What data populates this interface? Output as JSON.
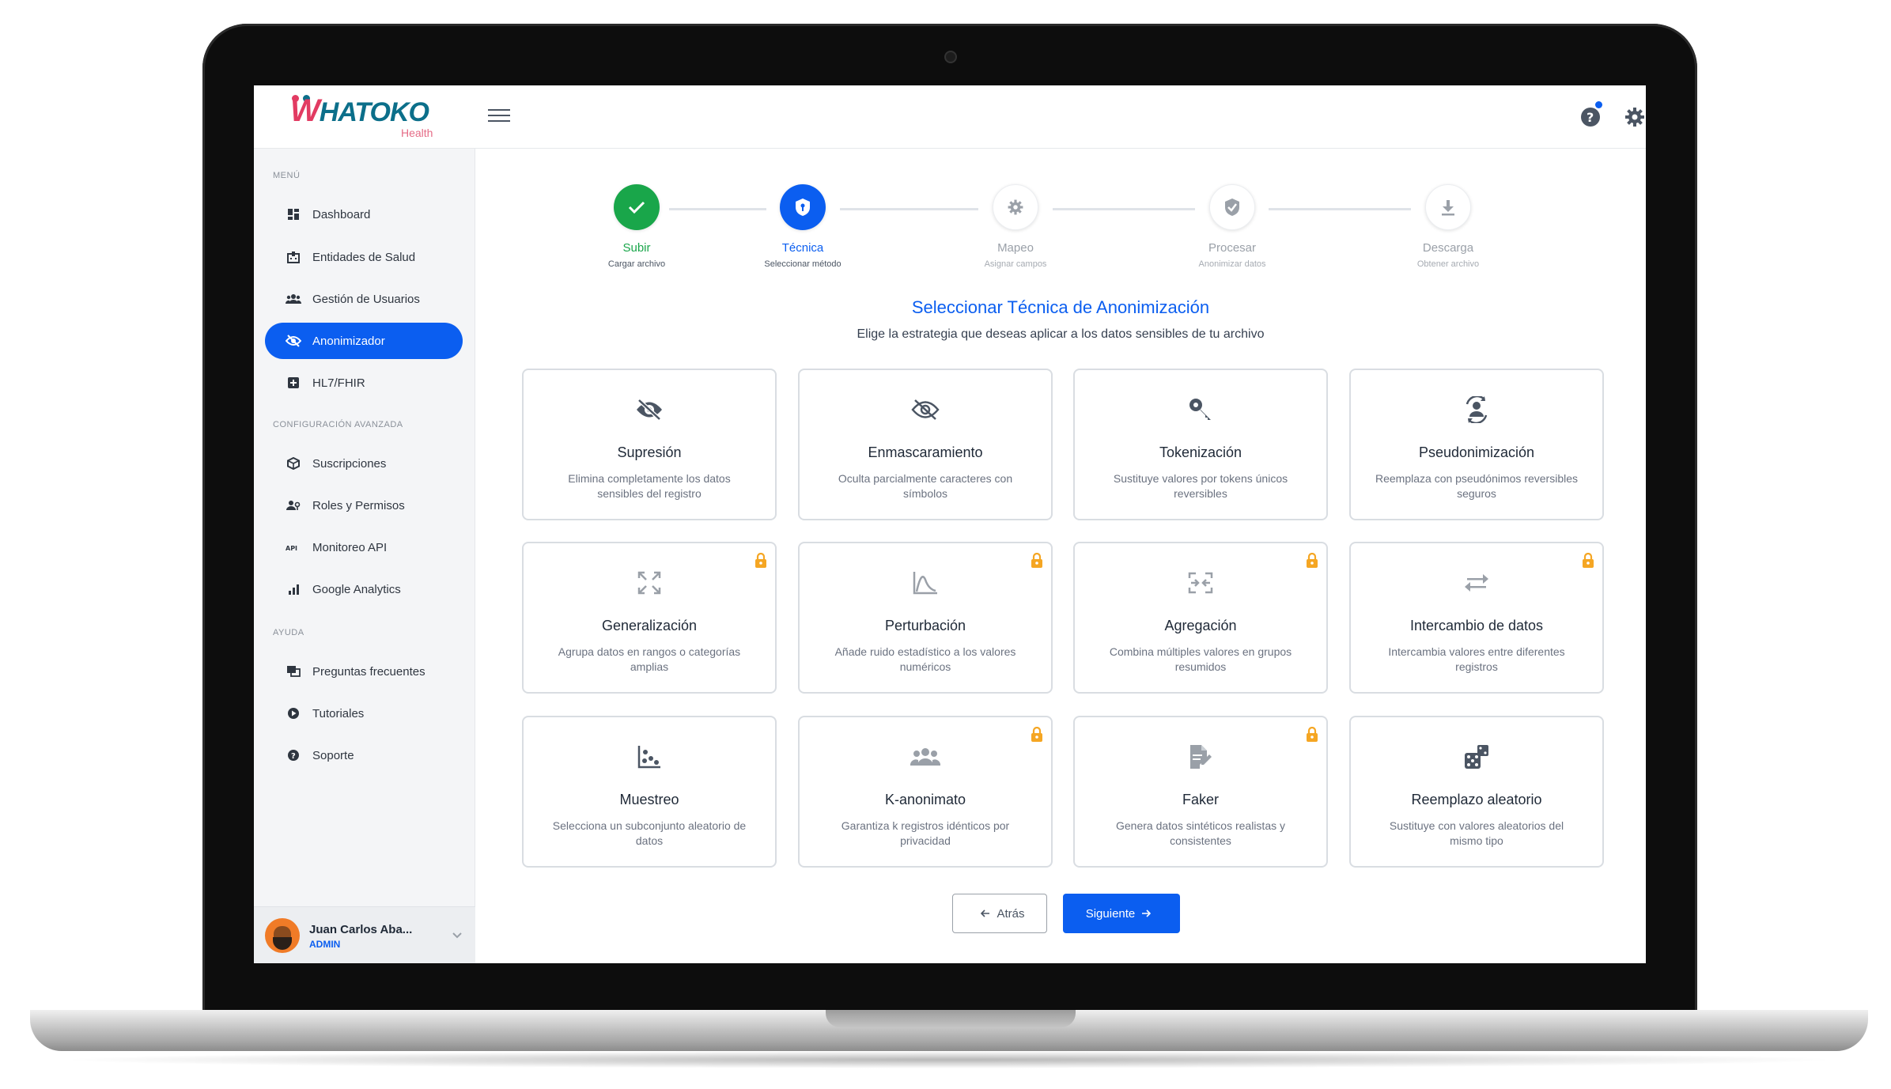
{
  "app": {
    "logo_text": "HATOKO",
    "logo_w": "W",
    "logo_sub": "Health"
  },
  "sidebar": {
    "sections": [
      "MENÚ",
      "CONFIGURACIÓN AVANZADA",
      "AYUDA"
    ],
    "items": [
      {
        "label": "Dashboard",
        "icon": "dashboard-icon"
      },
      {
        "label": "Entidades de Salud",
        "icon": "hospital-icon"
      },
      {
        "label": "Gestión de Usuarios",
        "icon": "users-icon"
      },
      {
        "label": "Anonimizador",
        "icon": "eye-off-icon",
        "active": true
      },
      {
        "label": "HL7/FHIR",
        "icon": "medical-plus-icon"
      },
      {
        "label": "Suscripciones",
        "icon": "cube-icon"
      },
      {
        "label": "Roles y Permisos",
        "icon": "user-key-icon"
      },
      {
        "label": "Monitoreo API",
        "icon": "api-icon"
      },
      {
        "label": "Google Analytics",
        "icon": "bar-chart-icon"
      },
      {
        "label": "Preguntas frecuentes",
        "icon": "faq-icon"
      },
      {
        "label": "Tutoriales",
        "icon": "play-circle-icon"
      },
      {
        "label": "Soporte",
        "icon": "help-circle-icon"
      }
    ],
    "user": {
      "name": "Juan Carlos Aba...",
      "role": "ADMIN"
    }
  },
  "stepper": [
    {
      "title": "Subir",
      "sub": "Cargar archivo",
      "state": "done",
      "icon": "check-icon"
    },
    {
      "title": "Técnica",
      "sub": "Seleccionar método",
      "state": "current",
      "icon": "shield-icon"
    },
    {
      "title": "Mapeo",
      "sub": "Asignar campos",
      "state": "pending",
      "icon": "gear-icon"
    },
    {
      "title": "Procesar",
      "sub": "Anonimizar datos",
      "state": "pending",
      "icon": "shield-check-icon"
    },
    {
      "title": "Descarga",
      "sub": "Obtener archivo",
      "state": "pending",
      "icon": "download-icon"
    }
  ],
  "main": {
    "title": "Seleccionar Técnica de Anonimización",
    "subtitle": "Elige la estrategia que deseas aplicar a los datos sensibles de tu archivo"
  },
  "techniques": [
    {
      "title": "Supresión",
      "desc": "Elimina completamente los datos sensibles del registro",
      "icon": "eye-off-icon",
      "locked": false
    },
    {
      "title": "Enmascaramiento",
      "desc": "Oculta parcialmente caracteres con símbolos",
      "icon": "eye-off-outline-icon",
      "locked": false
    },
    {
      "title": "Tokenización",
      "desc": "Sustituye valores por tokens únicos reversibles",
      "icon": "key-icon",
      "locked": false
    },
    {
      "title": "Pseudonimización",
      "desc": "Reemplaza con pseudónimos reversibles seguros",
      "icon": "user-sync-icon",
      "locked": false
    },
    {
      "title": "Generalización",
      "desc": "Agrupa datos en rangos o categorías amplias",
      "icon": "expand-icon",
      "locked": true
    },
    {
      "title": "Perturbación",
      "desc": "Añade ruido estadístico a los valores numéricos",
      "icon": "curve-icon",
      "locked": true
    },
    {
      "title": "Agregación",
      "desc": "Combina múltiples valores en grupos resumidos",
      "icon": "merge-icon",
      "locked": true
    },
    {
      "title": "Intercambio de datos",
      "desc": "Intercambia valores entre diferentes registros",
      "icon": "swap-icon",
      "locked": true
    },
    {
      "title": "Muestreo",
      "desc": "Selecciona un subconjunto aleatorio de datos",
      "icon": "scatter-icon",
      "locked": false
    },
    {
      "title": "K-anonimato",
      "desc": "Garantiza k registros idénticos por privacidad",
      "icon": "group-icon",
      "locked": true
    },
    {
      "title": "Faker",
      "desc": "Genera datos sintéticos realistas y consistentes",
      "icon": "file-edit-icon",
      "locked": true
    },
    {
      "title": "Reemplazo aleatorio",
      "desc": "Sustituye con valores aleatorios del mismo tipo",
      "icon": "dice-icon",
      "locked": false
    }
  ],
  "buttons": {
    "back": "Atrás",
    "next": "Siguiente"
  },
  "colors": {
    "accent": "#0b5ef0",
    "success": "#19a64a",
    "lock": "#f5a623"
  }
}
